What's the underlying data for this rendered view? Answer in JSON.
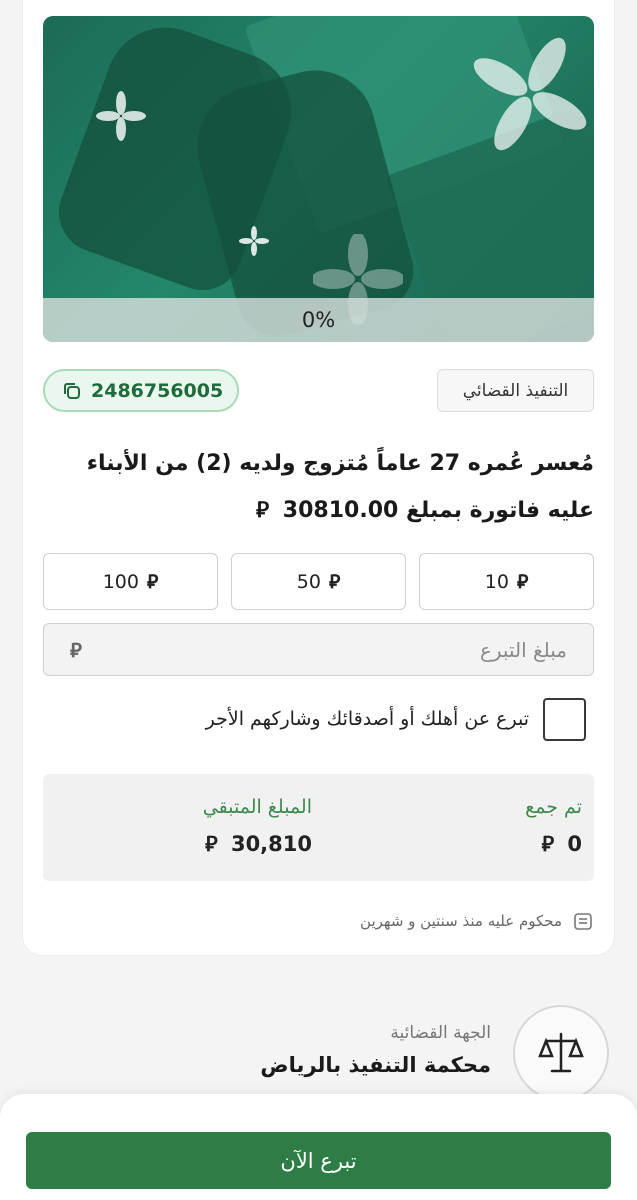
{
  "case": {
    "progress_label": "0%",
    "progress_value": 0,
    "code": "2486756005",
    "category": "التنفيذ القضائي",
    "title": "مُعسر عُمره 27 عاماً مُتزوج ولديه (2) من الأبناء عليه فاتورة بمبلغ 30810.00"
  },
  "amounts": [
    {
      "value": "100"
    },
    {
      "value": "50"
    },
    {
      "value": "10"
    }
  ],
  "donation_input": {
    "placeholder": "مبلغ التبرع"
  },
  "gift": {
    "label": "تبرع عن أهلك أو أصدقائك وشاركهم الأجر",
    "checked": false
  },
  "stats": {
    "collected_label": "تم جمع",
    "collected_value": "0",
    "remaining_label": "المبلغ المتبقي",
    "remaining_value": "30,810"
  },
  "judgment": {
    "text": "محكوم عليه منذ سنتين و شهرين"
  },
  "court": {
    "label": "الجهة القضائية",
    "name": "محكمة التنفيذ بالرياض"
  },
  "cta": {
    "label": "تبرع الآن"
  },
  "colors": {
    "primary": "#2f7d46",
    "accent_green": "#3c8a4d",
    "badge_bg": "#eaf7ee"
  },
  "icons": {
    "currency": "riyal-icon",
    "copy": "copy-icon",
    "calendar": "calendar-icon",
    "scales": "scales-icon"
  }
}
